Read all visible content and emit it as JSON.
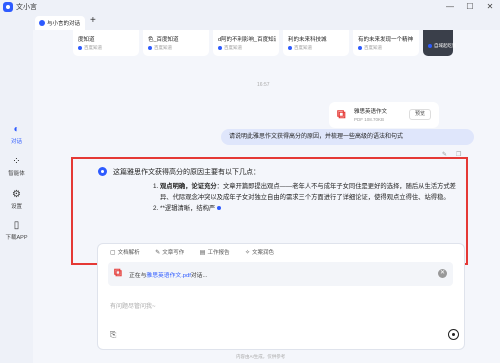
{
  "app": {
    "title": "文小言"
  },
  "window_controls": {
    "minimize": "—",
    "maximize": "☐",
    "close": "✕"
  },
  "tab": {
    "label": "与小言的对话"
  },
  "sidebar": [
    {
      "label": "对话",
      "icon": "chat-icon",
      "glyph": "◐"
    },
    {
      "label": "智能体",
      "icon": "agent-icon",
      "glyph": "⁘"
    },
    {
      "label": "设置",
      "icon": "settings-icon",
      "glyph": "⚙"
    },
    {
      "label": "下载APP",
      "icon": "download-app-icon",
      "glyph": "▯"
    }
  ],
  "cards": [
    {
      "title": "度知道",
      "source": "百度知道"
    },
    {
      "title": "色_百度知道",
      "source": "百度知道"
    },
    {
      "title": "d阿的不利影响_百度知道",
      "source": "百度知道"
    },
    {
      "title": "利的未来科技城",
      "source": "百度知道"
    },
    {
      "title": "有的未来发现一个精神",
      "source": "百度知道"
    },
    {
      "title": "",
      "source": "自域起吃饭"
    }
  ],
  "timestamp": "16:57",
  "file": {
    "name": "雅思英语作文",
    "meta": "PDF  108.70KB",
    "preview": "预览"
  },
  "user_message": "请说明此雅思作文获得高分的原因，并梳理一些高级的语法和句式",
  "message_tools": {
    "edit": "✎",
    "copy": "❐"
  },
  "answer": {
    "intro": "这篇雅思作文获得高分的原因主要有以下几点：",
    "points": [
      {
        "num": "1.",
        "lead": "观点明确，论证充分",
        "text": "：文章开篇即提出观点——老年人不与成年子女同住是更好的选择，随后从生活方式差异、代际观念冲突以及成年子女对独立自由的需求三个方面进行了详细论证，使得观点立得住、站得稳。"
      },
      {
        "num": "2.",
        "lead": "",
        "text": "**逻辑清晰，结构严"
      }
    ]
  },
  "composer": {
    "tools": [
      {
        "label": "文档解析",
        "glyph": "▢"
      },
      {
        "label": "文章写作",
        "glyph": "✎"
      },
      {
        "label": "工作报告",
        "glyph": "▤"
      },
      {
        "label": "文案润色",
        "glyph": "✧"
      }
    ],
    "attachment": {
      "prefix": "正在与",
      "file": "雅思英语作文.pdf",
      "suffix": "对话..."
    },
    "placeholder": "有问题尽管问我~"
  },
  "disclaimer": "内容由AI生成，仅供参考"
}
